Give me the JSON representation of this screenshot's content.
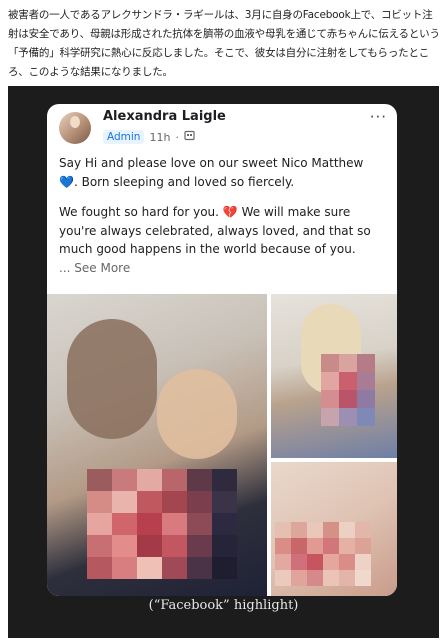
{
  "article": {
    "paragraph": "被害者の一人であるアレクサンドラ・ラギールは、3月に自身のFacebook上で、コビット注射は安全であり、母親は形成された抗体を臍帯の血液や母乳を通じて赤ちゃんに伝えるという「予備的」科学研究に熱心に反応しました。そこで、彼女は自分に注射をしてもらったところ、このような結果になりました。"
  },
  "post": {
    "author": "Alexandra Laigle",
    "role_badge": "Admin",
    "time": "11h",
    "separator": "·",
    "more_label": "···",
    "line1": "Say Hi and please love on our sweet Nico Matthew",
    "heart1": "💙",
    "line1b": ". Born sleeping and loved so fiercely.",
    "line2a": "We fought so hard for you.",
    "heart2": "💔",
    "line2b": " We will make sure you're always celebrated, always loved, and that so much good happens in the world because of you.",
    "see_more_prefix": "...",
    "see_more": "See More"
  },
  "caption": "(“Facebook” highlight)",
  "icons": [
    "avatar",
    "audience-icon",
    "more-options-icon"
  ]
}
